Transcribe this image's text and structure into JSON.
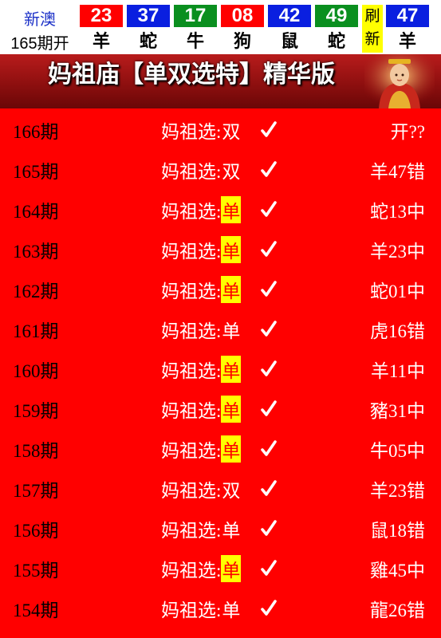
{
  "header": {
    "lottery_name": "新澳",
    "period_label": "165期开",
    "refresh_label": [
      "刷",
      "新"
    ],
    "balls": [
      {
        "number": "23",
        "zodiac": "羊",
        "color": "#ff0000"
      },
      {
        "number": "37",
        "zodiac": "蛇",
        "color": "#0a1fe0"
      },
      {
        "number": "17",
        "zodiac": "牛",
        "color": "#0a8f1f"
      },
      {
        "number": "08",
        "zodiac": "狗",
        "color": "#ff0000"
      },
      {
        "number": "42",
        "zodiac": "鼠",
        "color": "#0a1fe0"
      },
      {
        "number": "49",
        "zodiac": "蛇",
        "color": "#0a8f1f"
      },
      {
        "number": "47",
        "zodiac": "羊",
        "color": "#0a1fe0"
      }
    ]
  },
  "banner": {
    "title": "妈祖庙【单双选特】精华版"
  },
  "pick_label": "妈祖选:",
  "check_mark": "✓",
  "rows": [
    {
      "period": "166期",
      "pick": "双",
      "highlight": false,
      "result": "开??"
    },
    {
      "period": "165期",
      "pick": "双",
      "highlight": false,
      "result": "羊47错"
    },
    {
      "period": "164期",
      "pick": "单",
      "highlight": true,
      "result": "蛇13中"
    },
    {
      "period": "163期",
      "pick": "单",
      "highlight": true,
      "result": "羊23中"
    },
    {
      "period": "162期",
      "pick": "单",
      "highlight": true,
      "result": "蛇01中"
    },
    {
      "period": "161期",
      "pick": "单",
      "highlight": false,
      "result": "虎16错"
    },
    {
      "period": "160期",
      "pick": "单",
      "highlight": true,
      "result": "羊11中"
    },
    {
      "period": "159期",
      "pick": "单",
      "highlight": true,
      "result": "豬31中"
    },
    {
      "period": "158期",
      "pick": "单",
      "highlight": true,
      "result": "牛05中"
    },
    {
      "period": "157期",
      "pick": "双",
      "highlight": false,
      "result": "羊23错"
    },
    {
      "period": "156期",
      "pick": "单",
      "highlight": false,
      "result": "鼠18错"
    },
    {
      "period": "155期",
      "pick": "单",
      "highlight": true,
      "result": "雞45中"
    },
    {
      "period": "154期",
      "pick": "单",
      "highlight": false,
      "result": "龍26错"
    }
  ]
}
